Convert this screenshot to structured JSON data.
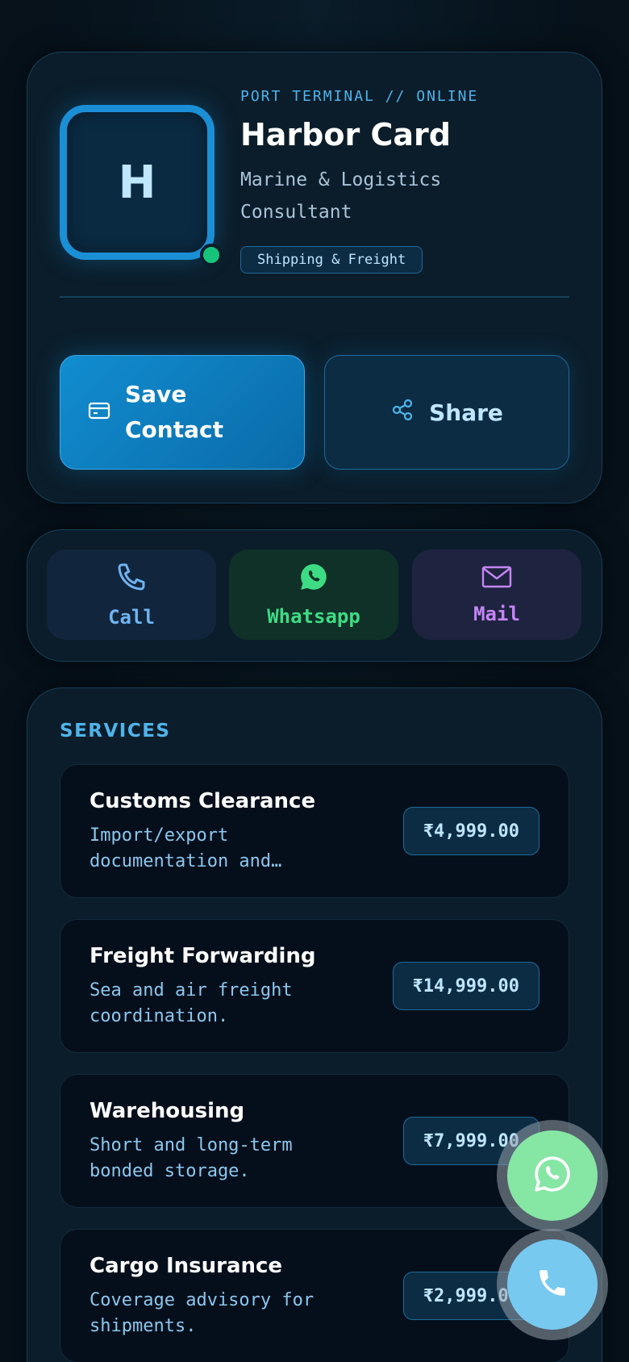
{
  "profile": {
    "avatar_initial": "H",
    "terminal_status": "PORT TERMINAL // ONLINE",
    "name": "Harbor Card",
    "title": "Marine & Logistics Consultant",
    "tag": "Shipping & Freight",
    "save_label": "Save Contact",
    "share_label": "Share",
    "status": "online"
  },
  "quick_actions": {
    "call": "Call",
    "whatsapp": "Whatsapp",
    "mail": "Mail"
  },
  "services": {
    "heading": "SERVICES",
    "items": [
      {
        "name": "Customs Clearance",
        "description": "Import/export documentation and…",
        "price": "₹4,999.00"
      },
      {
        "name": "Freight Forwarding",
        "description": "Sea and air freight coordination.",
        "price": "₹14,999.00"
      },
      {
        "name": "Warehousing",
        "description": "Short and long-term bonded storage.",
        "price": "₹7,999.00"
      },
      {
        "name": "Cargo Insurance",
        "description": "Coverage advisory for shipments.",
        "price": "₹2,999.00"
      }
    ]
  },
  "icons": {
    "save": "contact-card-icon",
    "share": "share-icon",
    "call": "phone-icon",
    "whatsapp": "whatsapp-icon",
    "mail": "mail-icon"
  },
  "colors": {
    "accent": "#1b8fd6",
    "whatsapp": "#3ddc84",
    "mail": "#c585f6",
    "status_online": "#17c37b"
  }
}
